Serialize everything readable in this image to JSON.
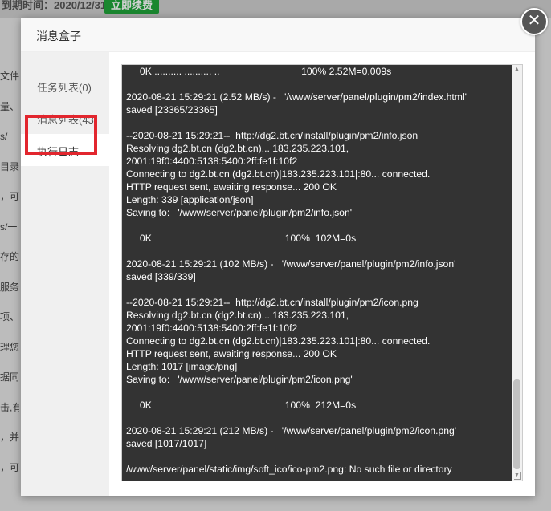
{
  "background": {
    "expiry_text": "到期时间：2020/12/31",
    "renew_button": "立即续费",
    "left_fragments": [
      "文件",
      "量、",
      "s/一",
      "目录",
      "，可",
      "s/一",
      "存的",
      "服务",
      "项、",
      "理您",
      "据同",
      "击,有",
      "，并",
      "，可"
    ]
  },
  "dialog": {
    "title": "消息盒子",
    "close_icon": "close-icon",
    "sidebar": {
      "items": [
        {
          "label": "任务列表(0)"
        },
        {
          "label": "消息列表(43)"
        },
        {
          "label": "执行日志"
        }
      ],
      "active_index": 2
    },
    "log_lines": [
      "     0K .......... .......... ..                              100% 2.52M=0.009s",
      "",
      "2020-08-21 15:29:21 (2.52 MB/s) -   '/www/server/panel/plugin/pm2/index.html'",
      "saved [23365/23365]",
      "",
      "--2020-08-21 15:29:21--  http://dg2.bt.cn/install/plugin/pm2/info.json",
      "Resolving dg2.bt.cn (dg2.bt.cn)... 183.235.223.101,",
      "2001:19f0:4400:5138:5400:2ff:fe1f:10f2",
      "Connecting to dg2.bt.cn (dg2.bt.cn)|183.235.223.101|:80... connected.",
      "HTTP request sent, awaiting response... 200 OK",
      "Length: 339 [application/json]",
      "Saving to:   '/www/server/panel/plugin/pm2/info.json'",
      "",
      "     0K                                                 100%  102M=0s",
      "",
      "2020-08-21 15:29:21 (102 MB/s) -   '/www/server/panel/plugin/pm2/info.json'",
      "saved [339/339]",
      "",
      "--2020-08-21 15:29:21--  http://dg2.bt.cn/install/plugin/pm2/icon.png",
      "Resolving dg2.bt.cn (dg2.bt.cn)... 183.235.223.101,",
      "2001:19f0:4400:5138:5400:2ff:fe1f:10f2",
      "Connecting to dg2.bt.cn (dg2.bt.cn)|183.235.223.101|:80... connected.",
      "HTTP request sent, awaiting response... 200 OK",
      "Length: 1017 [image/png]",
      "Saving to:   '/www/server/panel/plugin/pm2/icon.png'",
      "",
      "     0K                                                 100%  212M=0s",
      "",
      "2020-08-21 15:29:21 (212 MB/s) -   '/www/server/panel/plugin/pm2/icon.png'",
      "saved [1017/1017]",
      "",
      "/www/server/panel/static/img/soft_ico/ico-pm2.png: No such file or directory"
    ]
  },
  "colors": {
    "highlight": "#e2262e",
    "log_bg": "#333333",
    "renew_green": "#20a53a"
  }
}
